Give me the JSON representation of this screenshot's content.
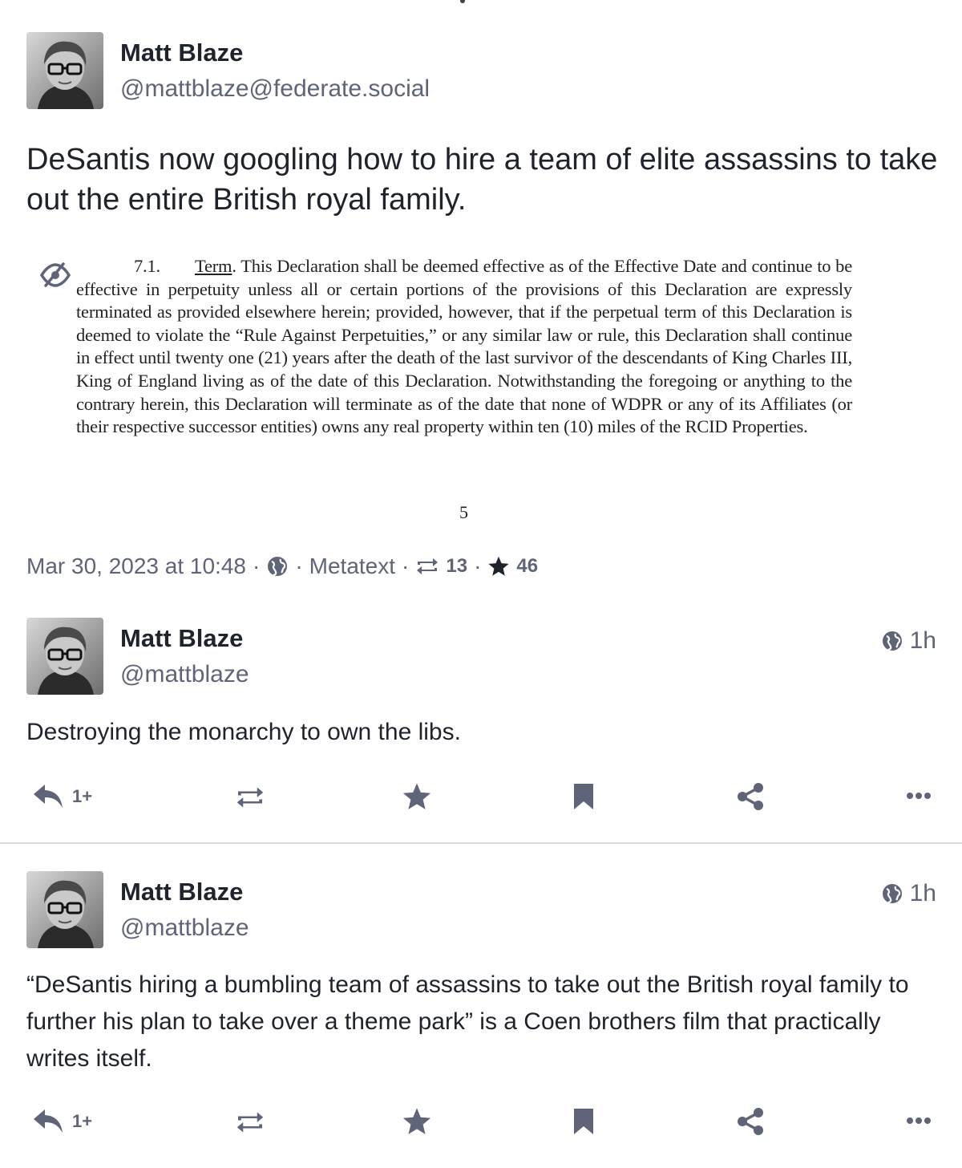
{
  "status": {
    "main": {
      "author_name": "Matt Blaze",
      "author_handle": "@mattblaze@federate.social",
      "text": "DeSantis now googling how to hire a team of elite assassins to take out the entire British royal family.",
      "attachment": {
        "section_number": "7.1.",
        "section_title": "Term",
        "lead": ". This Declaration shall be deemed effective as of the Effective Date and continue to be effective in perpetuity unless all or certain portions of the provisions of this Declaration are expressly terminated as provided elsewhere herein; provided, however, that if the perpetual term of this Declaration is deemed to violate the “Rule Against Perpetuities,” or any similar law or rule, this Declaration shall continue in effect until twenty one (21) years after the death of the last survivor of the descendants of King Charles III, King of England living as of the date of this Declaration. Notwithstanding the foregoing or anything to the contrary herein, this Declaration will terminate as of the date that none of WDPR or any of its Affiliates (or their respective successor entities) owns any real property within ten (10) miles of the RCID Properties.",
        "page_number": "5",
        "hide_icon": "eye-slash-icon"
      },
      "date": "Mar 30, 2023 at 10:48",
      "separator": "·",
      "visibility_icon": "globe-icon",
      "application": "Metatext",
      "boosts": "13",
      "favourites": "46"
    },
    "replies": [
      {
        "author_name": "Matt Blaze",
        "author_handle": "@mattblaze",
        "time": "1h",
        "text": "Destroying the monarchy to own the libs.",
        "reply_count": "1+"
      },
      {
        "author_name": "Matt Blaze",
        "author_handle": "@mattblaze",
        "time": "1h",
        "text": "“DeSantis hiring a bumbling team of assassins to take out the British royal family to further his plan to take over a theme park” is a Coen brothers film that practically writes itself.",
        "reply_count": "1+"
      }
    ]
  },
  "colors": {
    "text": "#1f232b",
    "secondary": "#5f6478",
    "divider": "#d5d8e0"
  }
}
